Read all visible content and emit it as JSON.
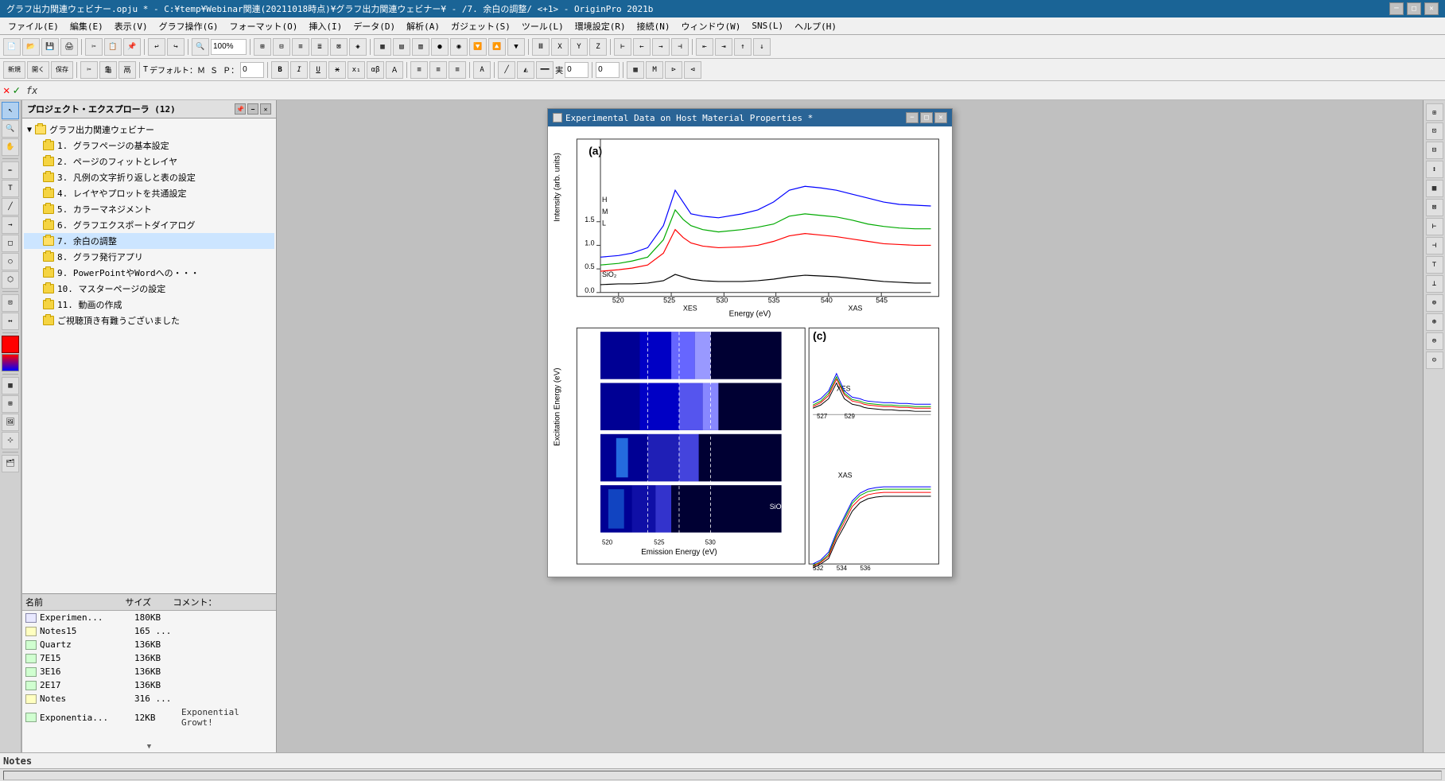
{
  "window": {
    "title": "グラフ出力関連ウェビナー.opju * - C:¥temp¥Webinar関連(20211018時点)¥グラフ出力関連ウェビナー¥ - /7. 余白の調整/ <+1> - OriginPro 2021b"
  },
  "menu": {
    "items": [
      "ファイル(E)",
      "編集(E)",
      "表示(V)",
      "グラフ操作(G)",
      "フォーマット(O)",
      "挿入(I)",
      "データ(D)",
      "解析(A)",
      "ガジェット(S)",
      "ツール(L)",
      "環境設定(R)",
      "接続(N)",
      "ウィンドウ(W)",
      "SNS(L)",
      "ヘルプ(H)"
    ]
  },
  "project_explorer": {
    "title": "プロジェクト・エクスプローラ (12)",
    "root_folder": "グラフ出力関連ウェビナー",
    "items": [
      {
        "label": "1. グラフページの基本設定",
        "type": "folder"
      },
      {
        "label": "2. ページのフィットとレイヤ",
        "type": "folder"
      },
      {
        "label": "3. 凡例の文字折り返しと表の設定",
        "type": "folder"
      },
      {
        "label": "4. レイヤやプロットを共通設定",
        "type": "folder"
      },
      {
        "label": "5. カラーマネジメント",
        "type": "folder"
      },
      {
        "label": "6. グラフエクスポートダイアログ",
        "type": "folder"
      },
      {
        "label": "7. 余白の調整",
        "type": "folder",
        "selected": true
      },
      {
        "label": "8. グラフ発行アプリ",
        "type": "folder"
      },
      {
        "label": "9. PowerPointやWordへの・・・",
        "type": "folder"
      },
      {
        "label": "10. マスターページの設定",
        "type": "folder"
      },
      {
        "label": "11. 動画の作成",
        "type": "folder"
      },
      {
        "label": "ご視聴頂き有難うございました",
        "type": "folder"
      }
    ]
  },
  "file_list": {
    "columns": [
      "名前",
      "サイズ",
      "コメント："
    ],
    "files": [
      {
        "name": "Experimen...",
        "size": "180KB",
        "comment": "",
        "type": "graph"
      },
      {
        "name": "Notes15",
        "size": "165 ...",
        "comment": "",
        "type": "notes"
      },
      {
        "name": "Quartz",
        "size": "136KB",
        "comment": "",
        "type": "worksheet"
      },
      {
        "name": "7E15",
        "size": "136KB",
        "comment": "",
        "type": "worksheet"
      },
      {
        "name": "3E16",
        "size": "136KB",
        "comment": "",
        "type": "worksheet"
      },
      {
        "name": "2E17",
        "size": "136KB",
        "comment": "",
        "type": "worksheet"
      },
      {
        "name": "Notes",
        "size": "316 ...",
        "comment": "",
        "type": "notes"
      },
      {
        "name": "Exponentia...",
        "size": "12KB",
        "comment": "Exponential Growt!",
        "type": "worksheet"
      }
    ]
  },
  "graph_window": {
    "title": "Experimental Data on Host Material Properties *",
    "buttons": [
      "−",
      "□",
      "×"
    ]
  },
  "formula_bar": {
    "cross": "✕",
    "check": "✓",
    "fx": "fx"
  },
  "status_bar": {
    "notes_label": "Notes"
  },
  "zoom": "100%",
  "colors": {
    "accent_blue": "#2a6496",
    "title_bg": "#1a6496",
    "selected_folder": "#c8e0ff",
    "graph_blue": "#0000ff",
    "graph_green": "#00aa00",
    "graph_red": "#ff0000",
    "graph_black": "#000000"
  }
}
